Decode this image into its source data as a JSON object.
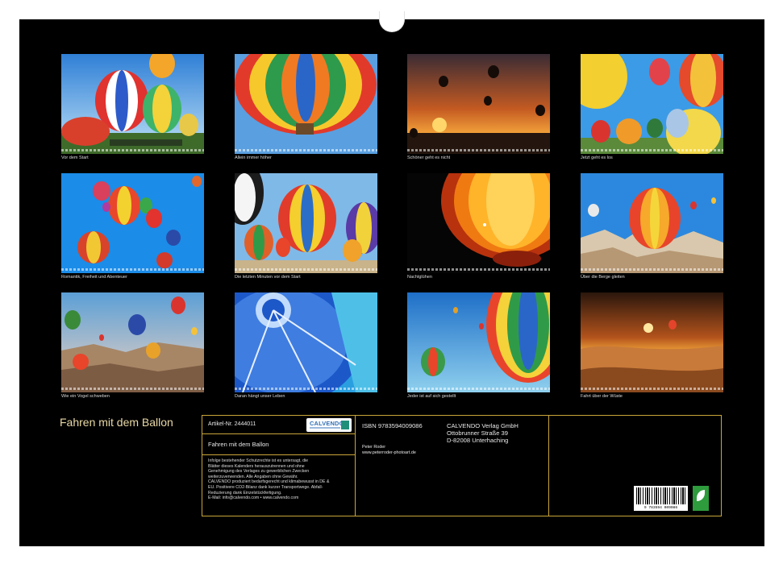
{
  "photos": [
    {
      "caption": "Vor dem Start",
      "image": "photo-balloons-before-start"
    },
    {
      "caption": "Allein immer höher",
      "image": "photo-balloon-from-below"
    },
    {
      "caption": "Schöner geht es nicht",
      "image": "photo-sunset-balloons"
    },
    {
      "caption": "Jetzt geht es los",
      "image": "photo-balloons-launch"
    },
    {
      "caption": "Romantik, Freiheit und Abenteuer",
      "image": "photo-balloons-blue-sky"
    },
    {
      "caption": "Die letzten Minuten vor dem Start",
      "image": "photo-balloons-inflating"
    },
    {
      "caption": "Nachtglühen",
      "image": "photo-night-glow"
    },
    {
      "caption": "Über die Berge gleiten",
      "image": "photo-balloon-over-rocks"
    },
    {
      "caption": "Wie ein Vogel schweben",
      "image": "photo-balloons-cappadocia"
    },
    {
      "caption": "Daran hängt unser Leben",
      "image": "photo-balloon-interior"
    },
    {
      "caption": "Jeder ist auf sich gestellt",
      "image": "photo-balloons-sky-closeup"
    },
    {
      "caption": "Fahrt über der Wüste",
      "image": "photo-balloon-desert"
    }
  ],
  "calendar_title": "Fahren mit dem Ballon",
  "info": {
    "article_no": "Artikel-Nr. 2444011",
    "product_title": "Fahren mit dem Ballon",
    "legal_lines": [
      "Infolge bestehender Schutzrechte ist es untersagt, die",
      "Blätter dieses Kalenders herauszutrennen und ohne",
      "Genehmigung des Verlages zu gewerblichen Zwecken",
      "weiterzuverwenden. Alle Angaben ohne Gewähr.",
      "CALVENDO produziert bedarfsgerecht und klimabewusst in DE &",
      "EU. Positivere CO2-Bilanz dank kurzer Transportwege. Abfall-",
      "Reduzierung dank Einzelstückfertigung.",
      "E-Mail: info@calvendo.com • www.calvendo.com"
    ],
    "isbn": "ISBN 9783594009086",
    "author": "Peter Roder",
    "author_url": "www.peterroder-photoart.de",
    "publisher_lines": [
      "CALVENDO Verlag GmbH",
      "Ottobrunner Straße 39",
      "D-82008 Unterhaching"
    ],
    "logo_text": "CALVENDO",
    "barcode_number": "9 783594 009086"
  }
}
